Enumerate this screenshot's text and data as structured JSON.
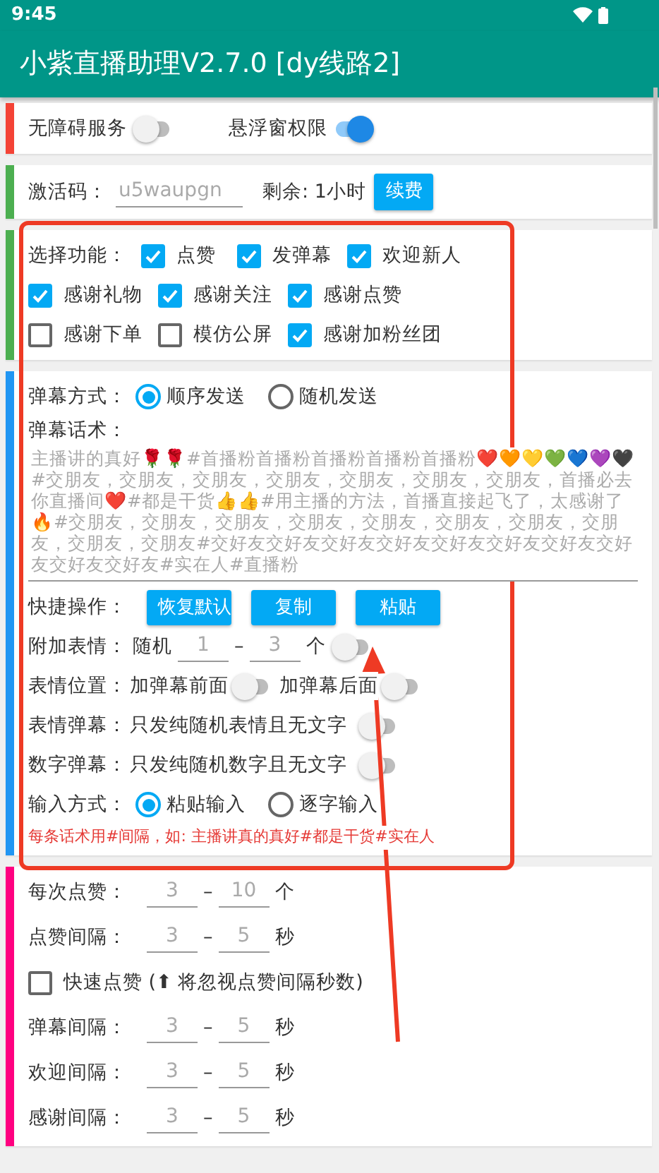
{
  "status_bar": {
    "time": "9:45"
  },
  "app_bar": {
    "title": "小紫直播助理V2.7.0 [dy线路2]"
  },
  "permissions": [
    {
      "label": "无障碍服务",
      "on": false
    },
    {
      "label": "悬浮窗权限",
      "on": true
    }
  ],
  "activation": {
    "label": "激活码：",
    "placeholder": "u5waupgn",
    "remaining": "剩余: 1小时",
    "button": "续费"
  },
  "features": {
    "label": "选择功能：",
    "options": [
      {
        "label": "点赞",
        "checked": true
      },
      {
        "label": "发弹幕",
        "checked": true
      },
      {
        "label": "欢迎新人",
        "checked": true
      },
      {
        "label": "感谢礼物",
        "checked": true
      },
      {
        "label": "感谢关注",
        "checked": true
      },
      {
        "label": "感谢点赞",
        "checked": true
      },
      {
        "label": "感谢下单",
        "checked": false
      },
      {
        "label": "模仿公屏",
        "checked": false
      },
      {
        "label": "感谢加粉丝团",
        "checked": true
      }
    ]
  },
  "danmaku": {
    "mode_label": "弹幕方式：",
    "modes": [
      {
        "label": "顺序发送",
        "selected": true
      },
      {
        "label": "随机发送",
        "selected": false
      }
    ],
    "script_label": "弹幕话术：",
    "script_placeholder": "主播讲的真好🌹🌹#首播粉首播粉首播粉首播粉首播粉❤️🧡💛💚💙💜🖤#交朋友，交朋友，交朋友，交朋友，交朋友，交朋友，交朋友，首播必去你直播间❤️#都是干货👍👍#用主播的方法，首播直接起飞了，太感谢了🔥#交朋友，交朋友，交朋友，交朋友，交朋友，交朋友，交朋友，交朋友，交朋友，交朋友#交好友交好友交好友交好友交好友交好友交好友交好友交好友交好友#实在人#直播粉",
    "quick_label": "快捷操作：",
    "quick_buttons": [
      "恢复默认",
      "复制",
      "粘贴"
    ],
    "emoji": {
      "label": "附加表情：",
      "prefix": "随机",
      "min": "1",
      "dash": "–",
      "max": "3",
      "unit": "个",
      "on": false
    },
    "position": {
      "label": "表情位置：",
      "options": [
        {
          "label": "加弹幕前面",
          "on": false
        },
        {
          "label": "加弹幕后面",
          "on": false
        }
      ]
    },
    "switch_rows": [
      {
        "label": "表情弹幕：",
        "text": "只发纯随机表情且无文字",
        "on": false
      },
      {
        "label": "数字弹幕：",
        "text": "只发纯随机数字且无文字",
        "on": false
      }
    ],
    "input_label": "输入方式：",
    "input_modes": [
      {
        "label": "粘贴输入",
        "selected": true
      },
      {
        "label": "逐字输入",
        "selected": false
      }
    ],
    "hint": "每条话术用#间隔，如: 主播讲真的真好#都是干货#实在人"
  },
  "timing": [
    {
      "kind": "range",
      "label": "每次点赞：",
      "min": "3",
      "dash": "–",
      "max": "10",
      "unit": "个"
    },
    {
      "kind": "range",
      "label": "点赞间隔：",
      "min": "3",
      "dash": "–",
      "max": "5",
      "unit": "秒"
    },
    {
      "kind": "checkbox",
      "label": "快速点赞 (⬆ 将忽视点赞间隔秒数)",
      "checked": false
    },
    {
      "kind": "range",
      "label": "弹幕间隔：",
      "min": "3",
      "dash": "–",
      "max": "5",
      "unit": "秒"
    },
    {
      "kind": "range",
      "label": "欢迎间隔：",
      "min": "3",
      "dash": "–",
      "max": "5",
      "unit": "秒"
    },
    {
      "kind": "range",
      "label": "感谢间隔：",
      "min": "3",
      "dash": "–",
      "max": "5",
      "unit": "秒"
    }
  ]
}
